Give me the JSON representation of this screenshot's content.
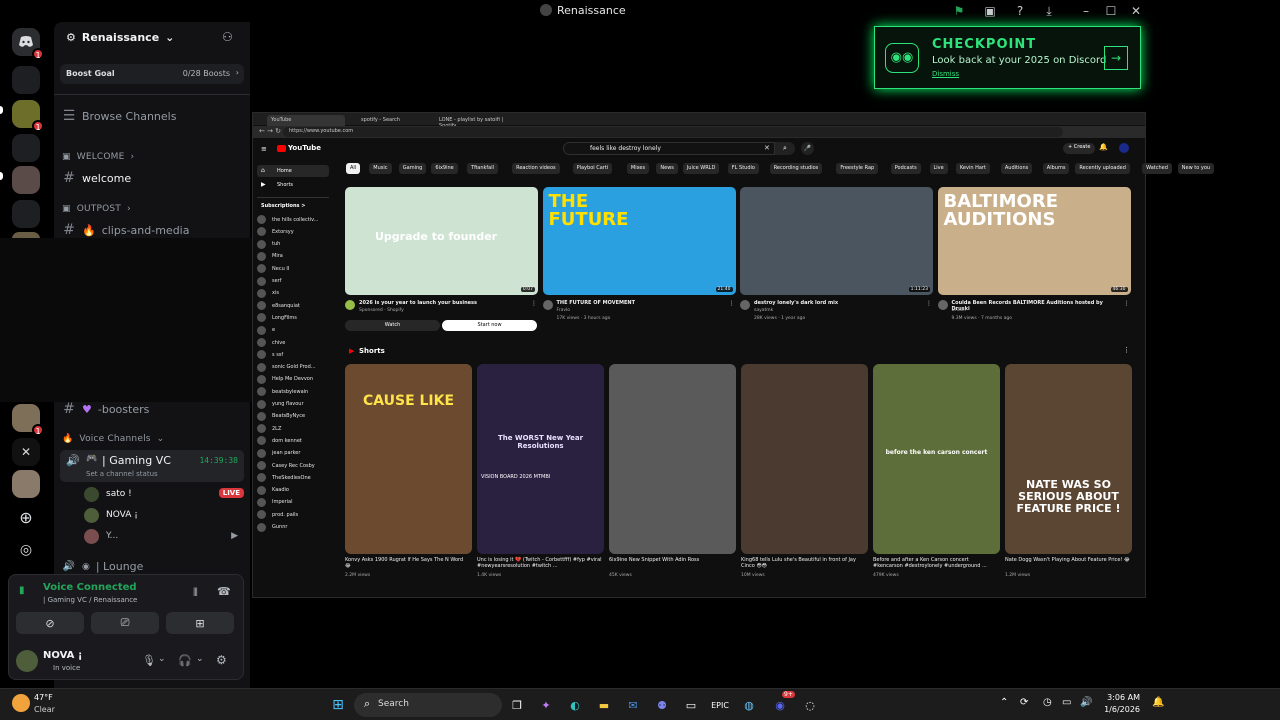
{
  "window": {
    "title": "Renaissance"
  },
  "colors": {
    "accent_green": "#23a55a",
    "live_red": "#da373c",
    "checkpoint_green": "#2fe37c",
    "yt_red": "#ff0000"
  },
  "server": {
    "name": "Renaissance",
    "boost_goal_label": "Boost Goal",
    "boost_count": "0/28 Boosts",
    "browse_channels": "Browse Channels",
    "categories": {
      "welcome": "WELCOME",
      "outpost": "OUTPOST",
      "voice": "Voice Channels"
    },
    "channels": {
      "welcome": "welcome",
      "clips": "clips-and-media",
      "boosters": "-boosters"
    },
    "voice_channels": [
      {
        "name": "| Gaming VC",
        "time": "14:39:38",
        "status": "Set a channel status"
      },
      {
        "name": "| Lounge"
      }
    ],
    "voice_members": [
      {
        "name": "sato !",
        "badge": "LIVE"
      },
      {
        "name": "NOVA ¡"
      },
      {
        "name": "Y..."
      }
    ]
  },
  "voice_panel": {
    "status": "Voice Connected",
    "location": "| Gaming VC / Renaissance"
  },
  "user_panel": {
    "name": "NOVA ¡",
    "status": "In voice"
  },
  "checkpoint": {
    "title": "CHECKPOINT",
    "subtitle": "Look back at your 2025 on Discord",
    "dismiss": "Dismiss"
  },
  "browser": {
    "tabs": [
      "YouTube",
      "spotify - Search",
      "LONE - playlist by satoifi | Spotify"
    ],
    "url": "https://www.youtube.com",
    "search_query": "feels like destroy lonely",
    "create_label": "+ Create",
    "logo": "YouTube",
    "chips": [
      "All",
      "Music",
      "Gaming",
      "6ix9ine",
      "Tfiankfall",
      "Reaction videos",
      "Playboi Carti",
      "Mixes",
      "News",
      "Juice WRLD",
      "FL Studio",
      "Recording studios",
      "Freestyle Rap",
      "Podcasts",
      "Live",
      "Kevin Hart",
      "Auditions",
      "Albums",
      "Recently uploaded",
      "Watched",
      "New to you"
    ],
    "sidebar": {
      "home": "Home",
      "shorts": "Shorts",
      "subscriptions": "Subscriptions >",
      "subs": [
        "the hills collectiv...",
        "Extorsyy",
        "tuh",
        "Mira",
        "Necu II",
        "serf",
        "xis",
        "e8sanquiat",
        "LongFilms",
        "e",
        "chive",
        "s ssf",
        "sonic Gold Prod...",
        "Help Me Devvon",
        "beatsbylewain",
        "yung flavour",
        "BeatsByNyce",
        "2LZ",
        "dom kennet",
        "jean parker",
        "Casey Rec Cosby",
        "TheSkedlesOne",
        "Kaadio",
        "Imperial",
        "prod. pails",
        "Gunnr"
      ]
    },
    "videos": [
      {
        "title": "2026 is your year to launch your business",
        "meta": "Sponsored · Shopify",
        "duration": "0:07",
        "thumb_text": "Upgrade to founder",
        "buttons": [
          "Watch",
          "Start now"
        ]
      },
      {
        "title": "THE FUTURE OF MOVEMENT",
        "meta": "17K views · 3 hours ago",
        "channel": "Fravlo",
        "duration": "21:40",
        "thumb_text": "THE FUTURE"
      },
      {
        "title": "destroy lonely's dark lord mix",
        "meta": "28K views · 1 year ago",
        "channel": "sayatmk",
        "duration": "1:11:23"
      },
      {
        "title": "Coulda Been Records BALTIMORE Auditions hosted by Druski",
        "meta": "9.3M views · 7 months ago",
        "channel": "Druski",
        "duration": "46:30",
        "thumb_text": "BALTIMORE AUDITIONS"
      }
    ],
    "shorts_label": "Shorts",
    "shorts": [
      {
        "title": "Konvy Asks 1900 Rugrat If He Says The N Word 😂",
        "meta": "2.2M views",
        "overlay": "CAUSE LIKE"
      },
      {
        "title": "Unc is losing it 💔 (Twitch - Corbettfff) #fyp #viral #newyearsresolution #twitch ...",
        "meta": "1.4K views",
        "overlay": "The WORST New Year Resolutions",
        "board": "VISION BOARD 2026 MTMBI"
      },
      {
        "title": "6ix9ine New Snippet With Adin Ross",
        "meta": "45K views"
      },
      {
        "title": "King68 tells Lulu she's Beautiful in front of Jay Cinco 😳😳",
        "meta": "10M views"
      },
      {
        "title": "Before and after a Ken Carson concert #kencarson #destroylonely #underground ...",
        "meta": "479K views",
        "overlay": "before the ken carson concert"
      },
      {
        "title": "Nate Dogg Wasn't Playing About Feature Price! 😂",
        "meta": "1.2M views",
        "overlay": "NATE WAS SO SERIOUS ABOUT FEATURE PRICE !"
      }
    ]
  },
  "taskbar": {
    "weather_temp": "47°F",
    "weather_desc": "Clear",
    "search": "Search",
    "time": "3:06 AM",
    "date": "1/6/2026",
    "discord_badge": "9+"
  }
}
